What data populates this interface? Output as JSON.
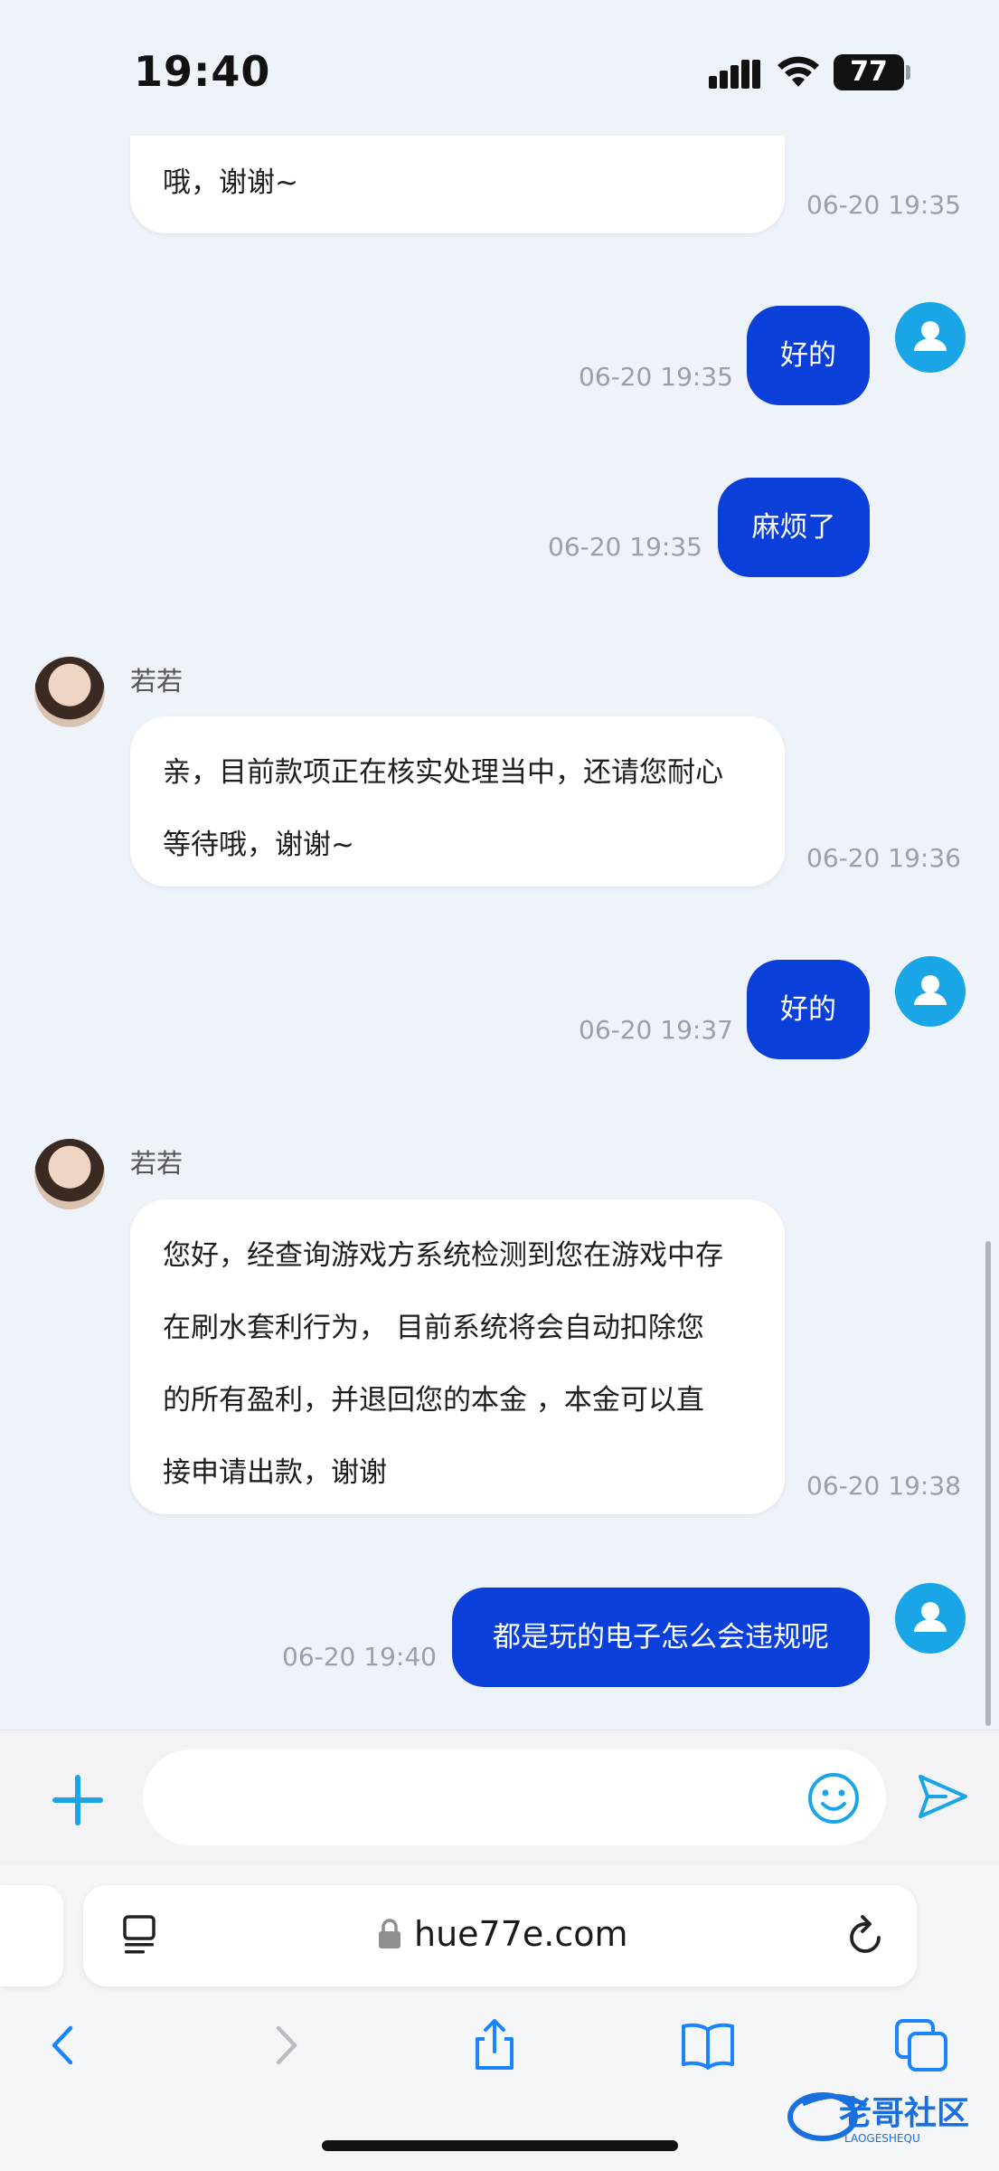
{
  "status_bar": {
    "time": "19:40",
    "battery": "77"
  },
  "agent_name": "若若",
  "messages": [
    {
      "side": "left",
      "text": "哦，谢谢~",
      "time": "06-20 19:35"
    },
    {
      "side": "right",
      "text": "好的",
      "time": "06-20 19:35"
    },
    {
      "side": "right",
      "text": "麻烦了",
      "time": "06-20 19:35"
    },
    {
      "side": "left",
      "name": "若若",
      "lines": [
        "亲，目前款项正在核实处理当中，还请您耐心",
        "等待哦，谢谢~"
      ],
      "time": "06-20 19:36"
    },
    {
      "side": "right",
      "text": "好的",
      "time": "06-20 19:37"
    },
    {
      "side": "left",
      "name": "若若",
      "lines": [
        "您好，经查询游戏方系统检测到您在游戏中存",
        "在刷水套利行为， 目前系统将会自动扣除您",
        "的所有盈利，并退回您的本金 ，本金可以直",
        "接申请出款，谢谢"
      ],
      "time": "06-20 19:38"
    },
    {
      "side": "right",
      "text": "都是玩的电子怎么会违规呢",
      "time": "06-20 19:40"
    }
  ],
  "input": {
    "placeholder": "",
    "value": ""
  },
  "browser": {
    "url": "hue77e.com"
  },
  "watermark": {
    "text": "老哥社区",
    "sub": "LAOGESHEQU"
  },
  "colors": {
    "accent": "#0a3fd9",
    "avatar_user": "#1aa6e6",
    "background": "#eef3fa"
  }
}
